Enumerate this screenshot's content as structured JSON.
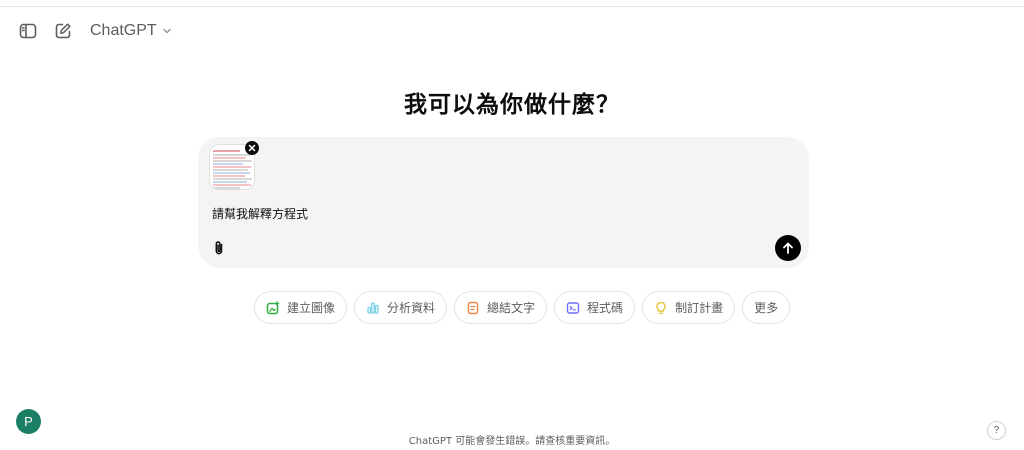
{
  "header": {
    "sidebar_icon": "sidebar-toggle-icon",
    "new_chat_icon": "new-chat-icon",
    "model_name": "ChatGPT",
    "model_chevron_icon": "chevron-down-icon"
  },
  "hero": {
    "title": "我可以為你做什麼？"
  },
  "composer": {
    "attachment_icon": "image-thumbnail",
    "remove_icon": "close-icon",
    "prompt": "請幫我解釋方程式",
    "attach_icon": "paperclip-icon",
    "send_icon": "arrow-up-icon"
  },
  "suggestions": [
    {
      "label": "建立圖像",
      "icon": "image-create-icon",
      "color": "#35ae47"
    },
    {
      "label": "分析資料",
      "icon": "bar-chart-icon",
      "color": "#76d0eb"
    },
    {
      "label": "總結文字",
      "icon": "document-icon",
      "color": "#ea8444"
    },
    {
      "label": "程式碼",
      "icon": "code-terminal-icon",
      "color": "#6c71ff"
    },
    {
      "label": "制訂計畫",
      "icon": "lightbulb-icon",
      "color": "#e2c541"
    },
    {
      "label": "更多"
    }
  ],
  "footer": {
    "avatar_letter": "P",
    "avatar_color": "#1a7f64",
    "disclaimer": "ChatGPT 可能會發生錯誤。請查核重要資訊。",
    "help_mark": "?"
  }
}
